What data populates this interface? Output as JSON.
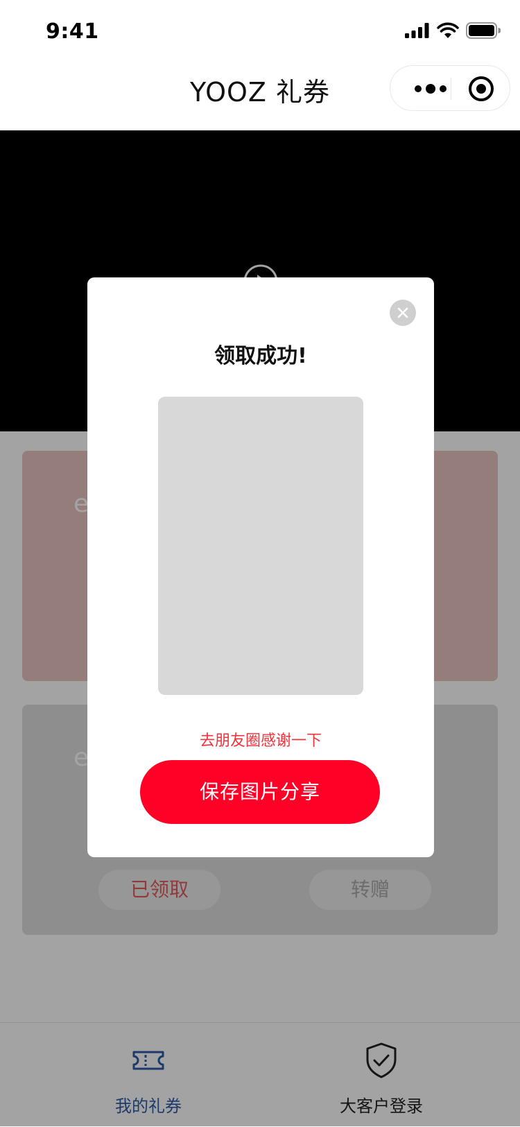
{
  "status_bar": {
    "time": "9:41"
  },
  "nav": {
    "title": "YOOZ 礼券"
  },
  "cards": [
    {
      "brand": "e",
      "button_left": "已领取",
      "button_right": "转赠"
    },
    {
      "brand": "e"
    }
  ],
  "modal": {
    "title": "领取成功!",
    "share_hint": "去朋友圈感谢一下",
    "save_button": "保存图片分享"
  },
  "tab_bar": {
    "items": [
      {
        "label": "我的礼券",
        "icon": "ticket-icon",
        "active": true
      },
      {
        "label": "大客户登录",
        "icon": "shield-check-icon",
        "active": false
      }
    ]
  },
  "colors": {
    "accent_red": "#ff0026",
    "hint_red": "#f0333b",
    "tab_active_blue": "#2d5da8"
  }
}
